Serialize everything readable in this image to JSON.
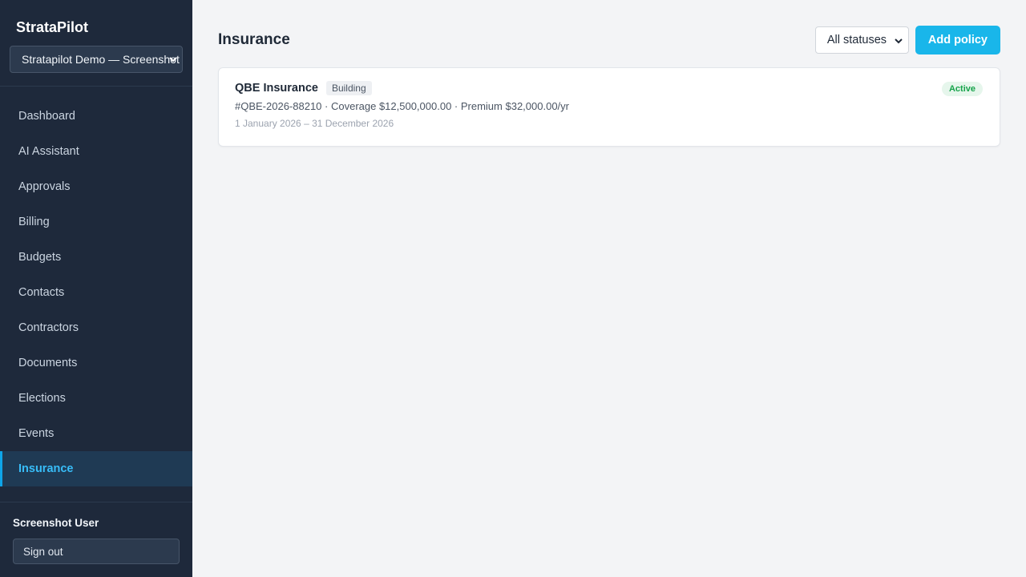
{
  "app": {
    "brand": "StrataPilot",
    "scheme_selector": "Stratapilot Demo — Screenshot"
  },
  "sidebar": {
    "items": [
      {
        "label": "Dashboard",
        "active": false
      },
      {
        "label": "AI Assistant",
        "active": false
      },
      {
        "label": "Approvals",
        "active": false
      },
      {
        "label": "Billing",
        "active": false
      },
      {
        "label": "Budgets",
        "active": false
      },
      {
        "label": "Contacts",
        "active": false
      },
      {
        "label": "Contractors",
        "active": false
      },
      {
        "label": "Documents",
        "active": false
      },
      {
        "label": "Elections",
        "active": false
      },
      {
        "label": "Events",
        "active": false
      },
      {
        "label": "Insurance",
        "active": true
      }
    ],
    "user_name": "Screenshot User",
    "sign_out_label": "Sign out"
  },
  "header": {
    "title": "Insurance",
    "status_filter": "All statuses",
    "add_button": "Add policy"
  },
  "policies": [
    {
      "insurer": "QBE Insurance",
      "type": "Building",
      "status": "Active",
      "details": "#QBE-2026-88210 · Coverage $12,500,000.00 · Premium $32,000.00/yr",
      "dates": "1 January 2026 – 31 December 2026"
    }
  ],
  "colors": {
    "sidebar_bg": "#1e293b",
    "accent": "#19b6ea",
    "active_status": "#16a34a"
  }
}
